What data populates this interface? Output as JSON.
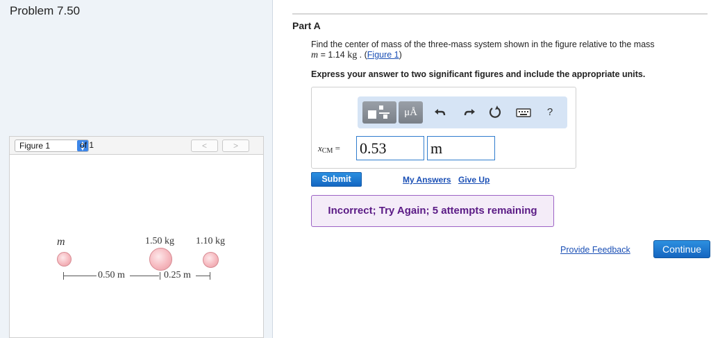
{
  "page": {
    "title": "Problem 7.50"
  },
  "figure_panel": {
    "select_value": "Figure 1",
    "of_label": "of 1",
    "prev_symbol": "<",
    "next_symbol": ">",
    "figure": {
      "mass_labels": [
        "m",
        "1.50 kg",
        "1.10 kg"
      ],
      "distance_labels": [
        "0.50 m",
        "0.25 m"
      ]
    }
  },
  "part": {
    "title": "Part A",
    "question_line1": "Find the center of mass of the three-mass system shown in the figure relative to the mass",
    "question_var": "m",
    "question_eq": " = 1.14 ",
    "question_unit": "kg",
    "question_after_unit": " . (",
    "figure_link": "Figure 1",
    "question_close": ")",
    "instruction": "Express your answer to two significant figures and include the appropriate units."
  },
  "answer": {
    "toolbar": {
      "template_icon": "template-icon",
      "units_button": "μÅ",
      "undo_icon": "undo-icon",
      "redo_icon": "redo-icon",
      "reset_icon": "reset-icon",
      "keyboard_icon": "keyboard-icon",
      "help_label": "?"
    },
    "label_var": "x",
    "label_sub": "CM",
    "label_eq": " =",
    "value": "0.53",
    "unit": "m"
  },
  "actions": {
    "submit": "Submit",
    "my_answers": "My Answers",
    "give_up": "Give Up"
  },
  "feedback": {
    "message": "Incorrect; Try Again; 5 attempts remaining"
  },
  "footer": {
    "provide_feedback": "Provide Feedback",
    "continue": "Continue"
  },
  "colors": {
    "accent": "#1467c2",
    "link": "#1a4fb5",
    "feedback_text": "#5a1a85",
    "feedback_border": "#9c62c5",
    "ball": "#f6b9bf"
  }
}
